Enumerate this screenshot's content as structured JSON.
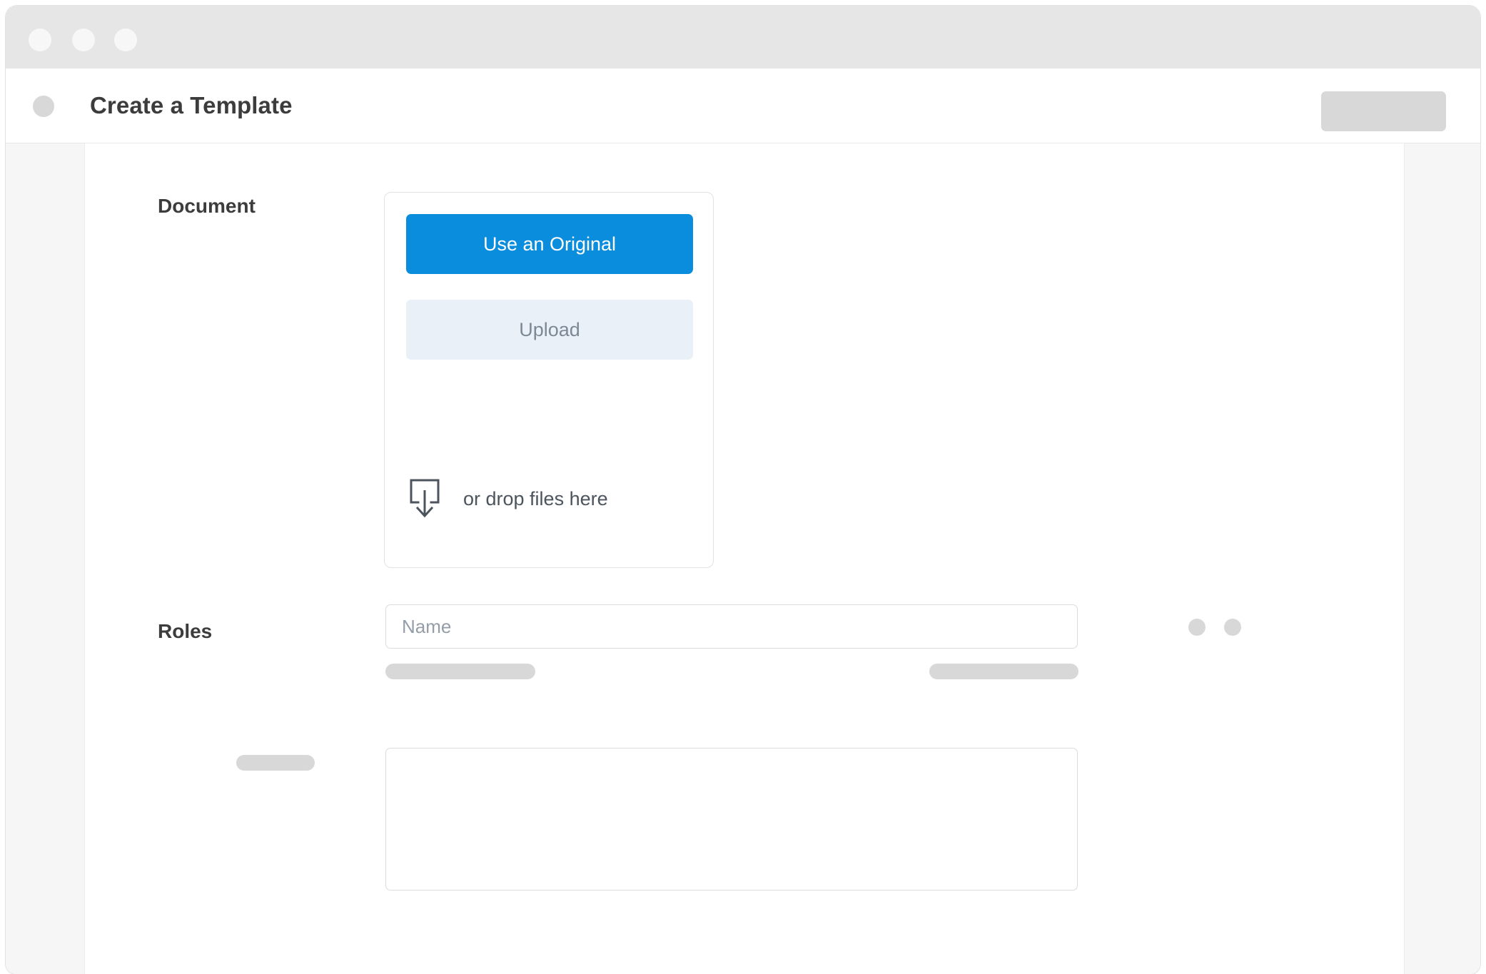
{
  "window": {
    "traffic_lights": [
      "close",
      "minimize",
      "maximize"
    ]
  },
  "header": {
    "title": "Create a Template",
    "avatar_placeholder": "avatar-placeholder",
    "action_placeholder": "action-button-placeholder"
  },
  "document_section": {
    "label": "Document",
    "use_original_label": "Use an Original",
    "upload_label": "Upload",
    "dropzone_label": "or drop files here",
    "dropzone_icon": "drop-tray-icon"
  },
  "roles_section": {
    "label": "Roles",
    "name_value": "",
    "name_placeholder": "Name",
    "dot_placeholders": [
      "role-dot-1",
      "role-dot-2"
    ],
    "bar_placeholders": [
      "roles-bar-left",
      "roles-bar-right"
    ]
  },
  "notes_section": {
    "label_placeholder": "notes-label-placeholder",
    "textarea_value": "",
    "textarea_placeholder": ""
  },
  "colors": {
    "accent_blue": "#0b8ddd",
    "upload_bg": "#eaf0f8",
    "upload_text": "#7d8896",
    "placeholder_gray": "#d8d8d8",
    "titlebar": "#e6e6e6",
    "body_bg": "#f6f6f6",
    "text_dark": "#3c3c3c",
    "border": "#e2e2e2"
  }
}
